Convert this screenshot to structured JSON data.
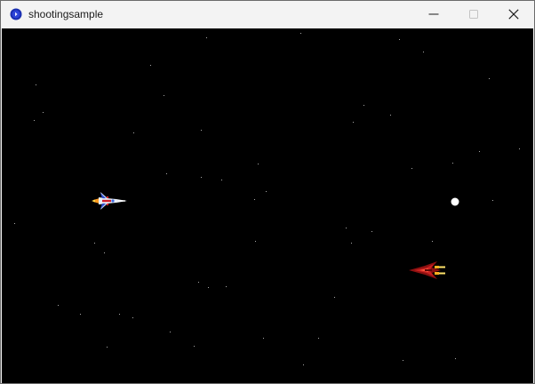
{
  "window": {
    "title": "shootingsample",
    "app_icon": "round-blue-app-icon",
    "controls": {
      "minimize_icon": "minimize-icon",
      "maximize_icon": "maximize-icon",
      "close_icon": "close-icon"
    }
  },
  "game": {
    "background_color": "#000000",
    "star_color": "#a8a8a8",
    "player_ship": {
      "icon": "white-fighter-ship-icon",
      "facing": "right"
    },
    "enemy_ship": {
      "icon": "red-enemy-ship-icon",
      "facing": "left"
    },
    "bullet": {
      "icon": "white-bullet-icon"
    }
  }
}
